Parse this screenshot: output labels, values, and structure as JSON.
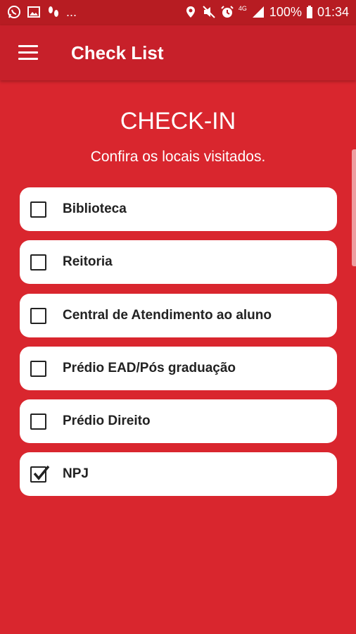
{
  "status_bar": {
    "left_icons": [
      "whatsapp-icon",
      "gallery-icon",
      "steps-icon"
    ],
    "overflow": "...",
    "right_icons": [
      "location-icon",
      "mute-icon",
      "alarm-icon",
      "network-4g-icon",
      "signal-icon"
    ],
    "network_label": "4G",
    "battery_percent": "100%",
    "time": "01:34"
  },
  "app_bar": {
    "menu_icon": "hamburger-menu-icon",
    "title": "Check List"
  },
  "page": {
    "title": "CHECK-IN",
    "subtitle": "Confira os locais visitados."
  },
  "checklist": {
    "items": [
      {
        "label": "Biblioteca",
        "checked": false
      },
      {
        "label": "Reitoria",
        "checked": false
      },
      {
        "label": "Central de Atendimento ao aluno",
        "checked": false
      },
      {
        "label": "Prédio EAD/Pós graduação",
        "checked": false
      },
      {
        "label": "Prédio Direito",
        "checked": false
      },
      {
        "label": "NPJ",
        "checked": true
      }
    ]
  },
  "colors": {
    "background": "#d9262e",
    "app_bar": "#c7202a",
    "status_bar": "#b71c22",
    "card": "#ffffff",
    "text_dark": "#222222"
  }
}
